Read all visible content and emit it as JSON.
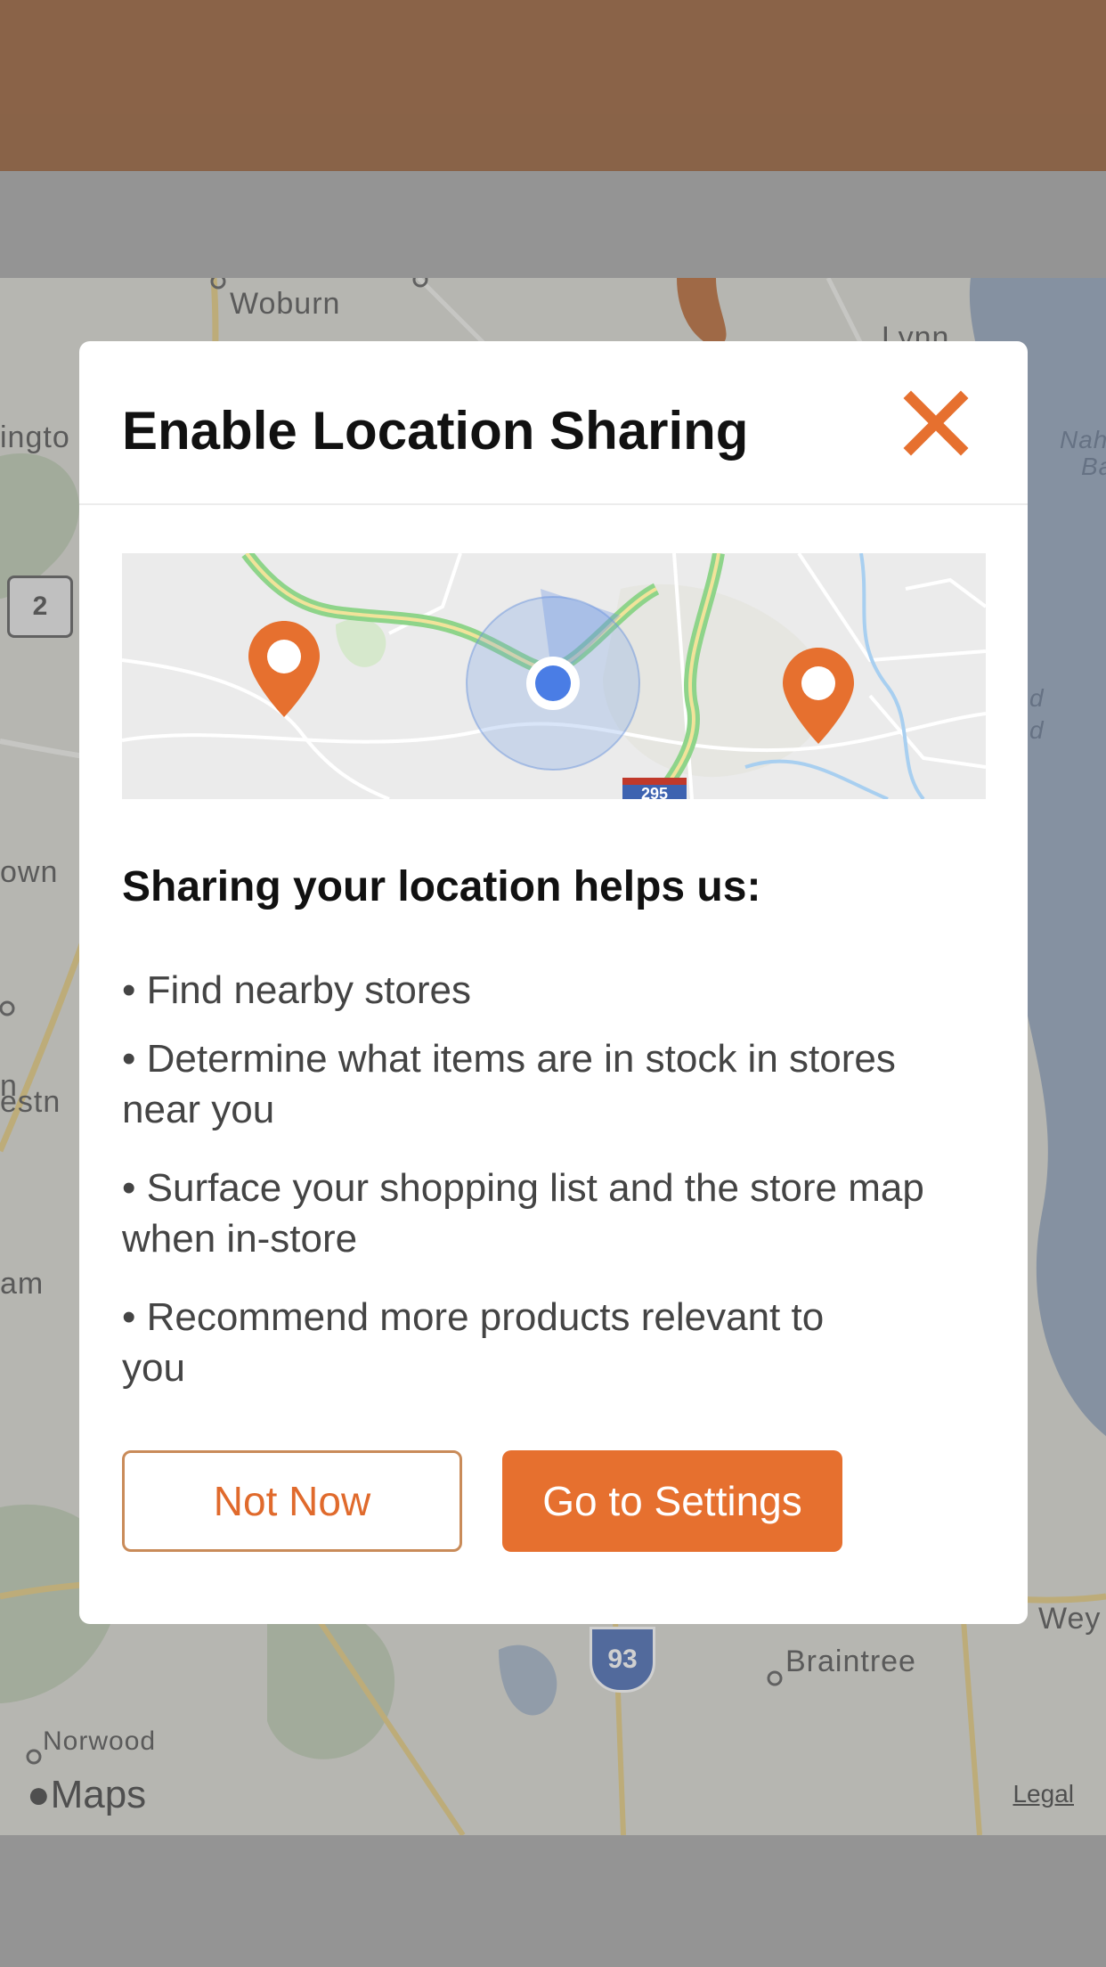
{
  "map": {
    "labels": [
      "Woburn",
      "Lynn",
      "Nah",
      "Ba",
      "ingto",
      "own",
      "estn",
      "am",
      "n",
      "Braintree",
      "Wey",
      "Norwood",
      "d",
      "d"
    ],
    "route_shield_2": "2",
    "interstate_93": "93",
    "maps_brand": "Maps",
    "legal": "Legal"
  },
  "modal": {
    "title": "Enable Location Sharing",
    "illustration_shield": "295",
    "question": "Sharing your location helps us:",
    "bullets": [
      "• Find nearby stores",
      "• Determine what items are in stock in stores near you",
      "• Surface your shopping list and the store map when in-store",
      "• Recommend more products relevant to you"
    ],
    "buttons": {
      "not_now": "Not Now",
      "settings": "Go to Settings"
    }
  },
  "colors": {
    "accent": "#e6702f",
    "topbar": "#93582f"
  }
}
